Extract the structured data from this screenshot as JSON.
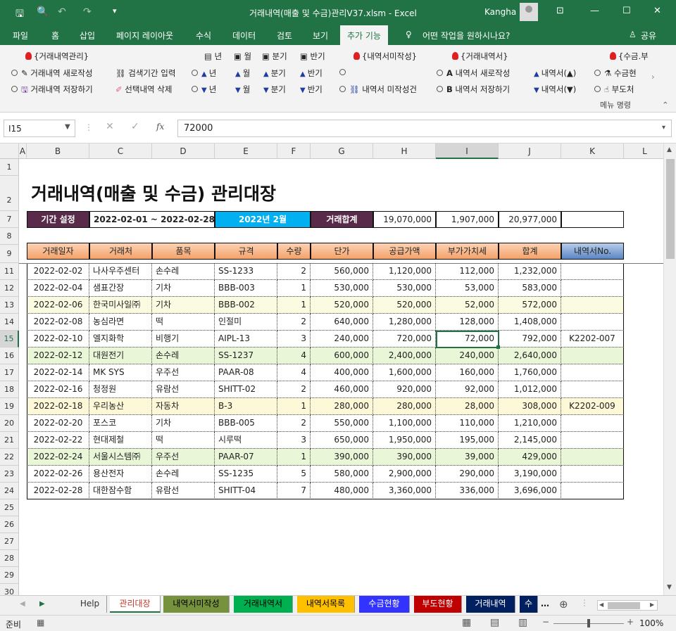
{
  "app": {
    "title": "거래내역(매출 및 수금)관리V37.xlsm  -  Excel",
    "user": "Kangha"
  },
  "tabs": [
    "파일",
    "홈",
    "삽입",
    "페이지 레이아웃",
    "수식",
    "데이터",
    "검토",
    "보기",
    "추가 기능",
    "어떤 작업을 원하시나요?",
    "공유"
  ],
  "ribbon": {
    "g1_head": "{거래내역관리}",
    "g1_a": "거래내역 새로작성",
    "g1_b": "검색기간 입력",
    "g1_c": "거래내역 저장하기",
    "g1_d": "선택내역 삭제",
    "period_head": [
      "년",
      "월",
      "분기",
      "반기"
    ],
    "up": [
      "년",
      "월",
      "분기",
      "반기"
    ],
    "down": [
      "년",
      "월",
      "분기",
      "반기"
    ],
    "g3_head": "{내역서미작성}",
    "g3_b": "내역서 미작성건",
    "g4_head": "{거래내역서}",
    "g4_a": "내역서 새로작성",
    "g4_b": "내역서 저장하기",
    "g4_c": "내역서(▲)",
    "g4_d": "내역서(▼)",
    "g5_head": "{수금.부",
    "g5_a": "수금현",
    "g5_b": "부도처",
    "group_label": "메뉴 명령"
  },
  "formula": {
    "namebox": "I15",
    "value": "72000"
  },
  "columns": [
    "A",
    "B",
    "C",
    "D",
    "E",
    "F",
    "G",
    "H",
    "I",
    "J",
    "K",
    "L"
  ],
  "rows": [
    "1",
    "2",
    "7",
    "8",
    "9",
    "11",
    "12",
    "13",
    "14",
    "15",
    "16",
    "17",
    "18",
    "19",
    "20",
    "21",
    "22",
    "23",
    "24",
    "25",
    "26",
    "27",
    "28",
    "29",
    "30"
  ],
  "sheet": {
    "title": "거래내역(매출 및 수금) 관리대장",
    "period_label": "기간 설정",
    "period_value": "2022-02-01 ~ 2022-02-28",
    "month": "2022년 2월",
    "total_label": "거래합계",
    "totals": [
      "19,070,000",
      "1,907,000",
      "20,977,000"
    ],
    "headers": [
      "거래일자",
      "거래처",
      "품목",
      "규격",
      "수량",
      "단가",
      "공급가액",
      "부가가치세",
      "합계",
      "내역서No."
    ],
    "data": [
      [
        "2022-02-02",
        "나사우주센터",
        "손수레",
        "SS-1233",
        "2",
        "560,000",
        "1,120,000",
        "112,000",
        "1,232,000",
        ""
      ],
      [
        "2022-02-04",
        "샘표간장",
        "기차",
        "BBB-003",
        "1",
        "530,000",
        "530,000",
        "53,000",
        "583,000",
        ""
      ],
      [
        "2022-02-06",
        "한국미사일㈜",
        "기차",
        "BBB-002",
        "1",
        "520,000",
        "520,000",
        "52,000",
        "572,000",
        ""
      ],
      [
        "2022-02-08",
        "농심라면",
        "떡",
        "인절미",
        "2",
        "640,000",
        "1,280,000",
        "128,000",
        "1,408,000",
        ""
      ],
      [
        "2022-02-10",
        "엘지화학",
        "비행기",
        "AIPL-13",
        "3",
        "240,000",
        "720,000",
        "72,000",
        "792,000",
        "K2202-007"
      ],
      [
        "2022-02-12",
        "대원전기",
        "손수레",
        "SS-1237",
        "4",
        "600,000",
        "2,400,000",
        "240,000",
        "2,640,000",
        ""
      ],
      [
        "2022-02-14",
        "MK SYS",
        "우주선",
        "PAAR-08",
        "4",
        "400,000",
        "1,600,000",
        "160,000",
        "1,760,000",
        ""
      ],
      [
        "2022-02-16",
        "청정원",
        "유람선",
        "SHITT-02",
        "2",
        "460,000",
        "920,000",
        "92,000",
        "1,012,000",
        ""
      ],
      [
        "2022-02-18",
        "우리농산",
        "자동차",
        "B-3",
        "1",
        "280,000",
        "280,000",
        "28,000",
        "308,000",
        "K2202-009"
      ],
      [
        "2022-02-20",
        "포스코",
        "기차",
        "BBB-005",
        "2",
        "550,000",
        "1,100,000",
        "110,000",
        "1,210,000",
        ""
      ],
      [
        "2022-02-22",
        "현대제철",
        "떡",
        "시루떡",
        "3",
        "650,000",
        "1,950,000",
        "195,000",
        "2,145,000",
        ""
      ],
      [
        "2022-02-24",
        "서울시스템㈜",
        "우주선",
        "PAAR-07",
        "1",
        "390,000",
        "390,000",
        "39,000",
        "429,000",
        ""
      ],
      [
        "2022-02-26",
        "용산전자",
        "손수레",
        "SS-1235",
        "5",
        "580,000",
        "2,900,000",
        "290,000",
        "3,190,000",
        ""
      ],
      [
        "2022-02-28",
        "대한잠수함",
        "유람선",
        "SHITT-04",
        "7",
        "480,000",
        "3,360,000",
        "336,000",
        "3,696,000",
        ""
      ]
    ],
    "row_fills": [
      "#fff",
      "#fff",
      "#fafbe0",
      "#fff",
      "#fff",
      "#eaf6d8",
      "#fff",
      "#fff",
      "#fdf8d7",
      "#fff",
      "#fff",
      "#eaf6d8",
      "#fff",
      "#fff"
    ]
  },
  "sheet_tabs": [
    {
      "label": "Help",
      "bg": "#f0f0f0",
      "fg": "#333"
    },
    {
      "label": "관리대장",
      "bg": "#ffffff",
      "fg": "#c0392b"
    },
    {
      "label": "내역서미작성",
      "bg": "#76923c",
      "fg": "#000"
    },
    {
      "label": "거래내역서",
      "bg": "#00b050",
      "fg": "#000"
    },
    {
      "label": "내역서목록",
      "bg": "#ffc000",
      "fg": "#000"
    },
    {
      "label": "수금현황",
      "bg": "#3333ff",
      "fg": "#fff"
    },
    {
      "label": "부도현황",
      "bg": "#c00000",
      "fg": "#fff"
    },
    {
      "label": "거래내역",
      "bg": "#002060",
      "fg": "#fff"
    },
    {
      "label": "수",
      "bg": "#002060",
      "fg": "#fff"
    }
  ],
  "status": {
    "ready": "준비",
    "zoom": "100%"
  }
}
